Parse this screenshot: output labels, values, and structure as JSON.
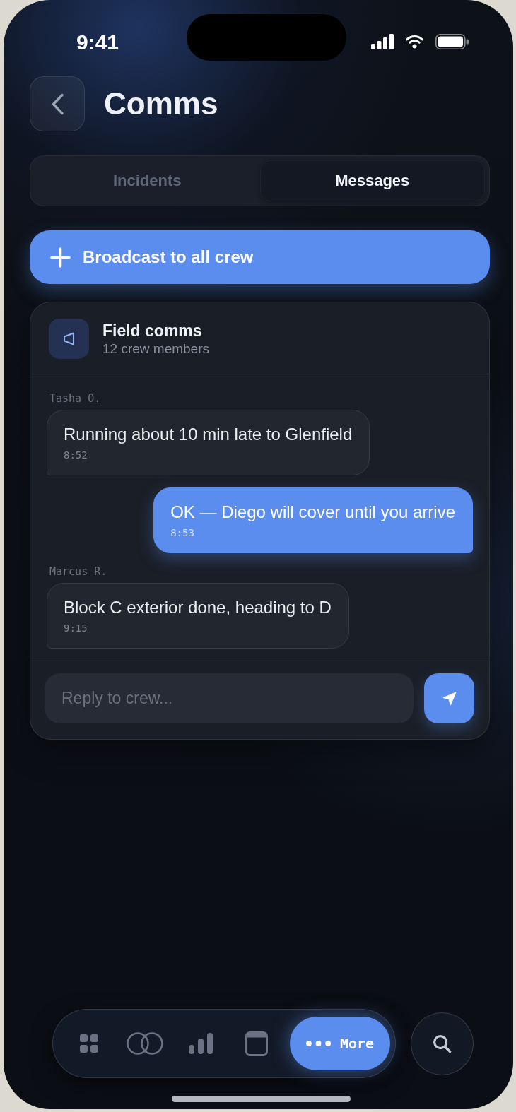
{
  "status_bar": {
    "time": "9:41"
  },
  "header": {
    "title": "Comms"
  },
  "tabs": [
    {
      "label": "Incidents",
      "selected": false
    },
    {
      "label": "Messages",
      "selected": true
    }
  ],
  "broadcast_button": {
    "label": "Broadcast to all crew"
  },
  "channel": {
    "name": "Field comms",
    "members": "12 crew members",
    "messages": [
      {
        "sender": "Tasha O.",
        "text": "Running about 10 min late to Glenfield",
        "time": "8:52",
        "outgoing": false
      },
      {
        "text": "OK — Diego will cover until you arrive",
        "time": "8:53",
        "outgoing": true
      },
      {
        "sender": "Marcus R.",
        "text": "Block C exterior done, heading to D",
        "time": "9:15",
        "outgoing": false
      }
    ],
    "reply": {
      "placeholder": "Reply to crew..."
    }
  },
  "bottom_nav": {
    "items": [
      {
        "selected": false
      },
      {
        "selected": false
      },
      {
        "selected": false
      },
      {
        "selected": false
      },
      {
        "label": "More",
        "selected": true
      }
    ]
  }
}
